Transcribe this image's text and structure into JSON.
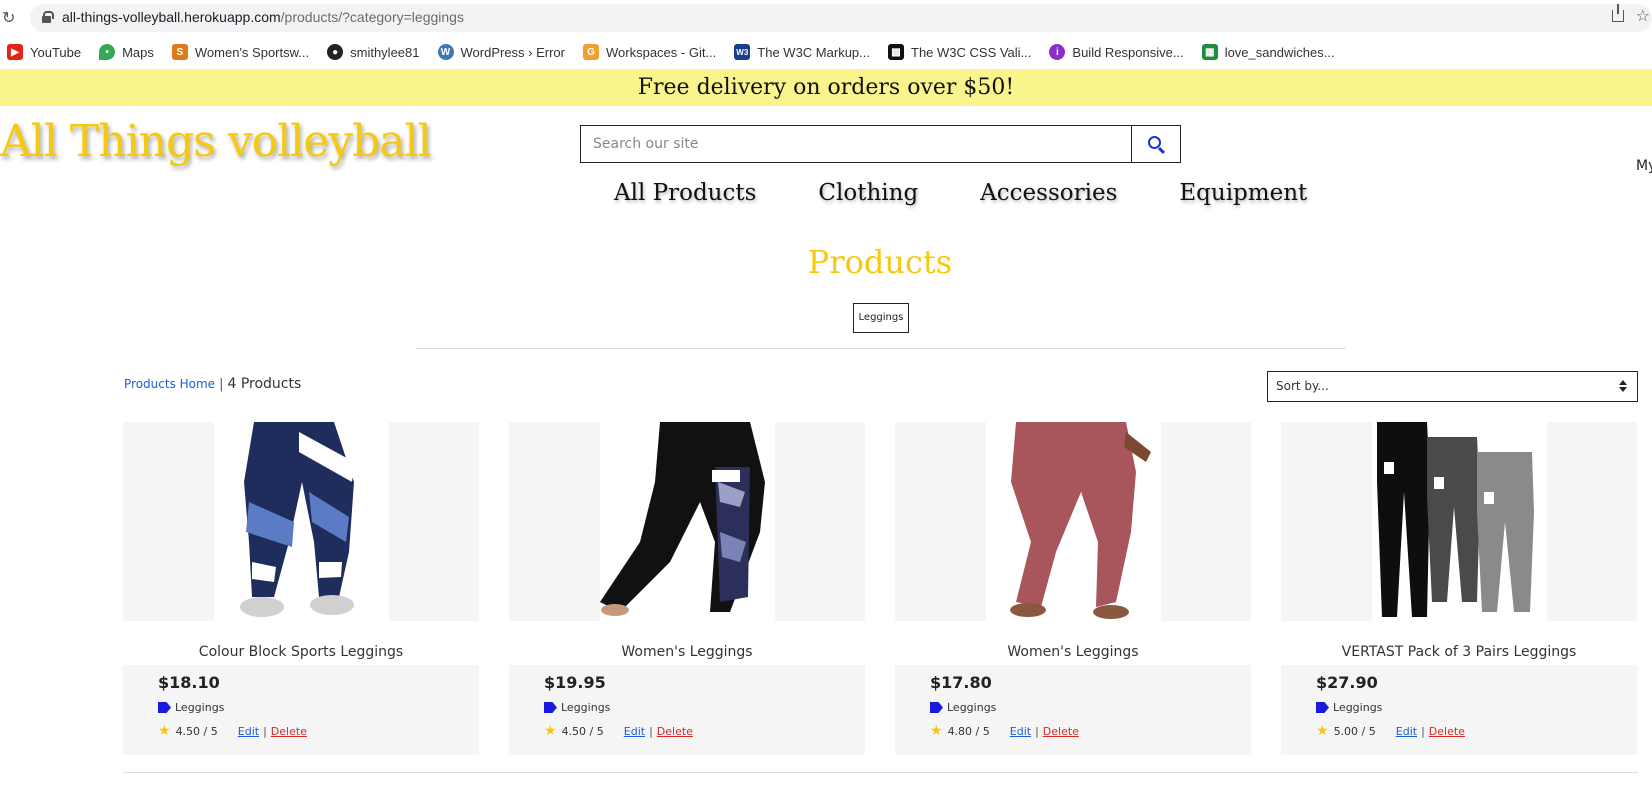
{
  "browser": {
    "url_domain": "all-things-volleyball.herokuapp.com",
    "url_path": "/products/?category=leggings",
    "bookmarks": [
      {
        "label": "YouTube",
        "icon": "youtube-icon",
        "color": "#e62117"
      },
      {
        "label": "Maps",
        "icon": "maps-icon",
        "color": "#34a853"
      },
      {
        "label": "Women's Sportsw...",
        "icon": "store-icon",
        "color": "#e07b1a"
      },
      {
        "label": "smithylee81",
        "icon": "github-icon",
        "color": "#222222"
      },
      {
        "label": "WordPress › Error",
        "icon": "wordpress-icon",
        "color": "#3c78b4"
      },
      {
        "label": "Workspaces - Git...",
        "icon": "gitpod-icon",
        "color": "#f0a030"
      },
      {
        "label": "The W3C Markup...",
        "icon": "w3c-icon",
        "color": "#1b3d8f"
      },
      {
        "label": "The W3C CSS Vali...",
        "icon": "css-validator-icon",
        "color": "#111111"
      },
      {
        "label": "Build Responsive...",
        "icon": "course-icon",
        "color": "#8b2fc9"
      },
      {
        "label": "love_sandwiches...",
        "icon": "sheets-icon",
        "color": "#1e8e3e"
      }
    ]
  },
  "site": {
    "banner_text": "Free delivery on orders over $50!",
    "logo_text": "All Things volleyball",
    "search_placeholder": "Search our site",
    "account_text": "My",
    "nav": [
      "All Products",
      "Clothing",
      "Accessories",
      "Equipment"
    ],
    "brand_yellow": "#f6c90e",
    "banner_color": "#f9f48c"
  },
  "page": {
    "heading": "Products",
    "category_chip": "Leggings",
    "breadcrumb_link": "Products Home",
    "breadcrumb_sep": "|",
    "product_count": "4 Products",
    "sort_selected": "Sort by..."
  },
  "products": [
    {
      "title": "Colour Block Sports Leggings",
      "price": "$18.10",
      "category": "Leggings",
      "rating": "4.50 / 5",
      "edit": "Edit",
      "sep": "|",
      "delete": "Delete"
    },
    {
      "title": "Women's Leggings",
      "price": "$19.95",
      "category": "Leggings",
      "rating": "4.50 / 5",
      "edit": "Edit",
      "sep": "|",
      "delete": "Delete"
    },
    {
      "title": "Women's Leggings",
      "price": "$17.80",
      "category": "Leggings",
      "rating": "4.80 / 5",
      "edit": "Edit",
      "sep": "|",
      "delete": "Delete"
    },
    {
      "title": "VERTAST Pack of 3 Pairs Leggings",
      "price": "$27.90",
      "category": "Leggings",
      "rating": "5.00 / 5",
      "edit": "Edit",
      "sep": "|",
      "delete": "Delete"
    }
  ]
}
